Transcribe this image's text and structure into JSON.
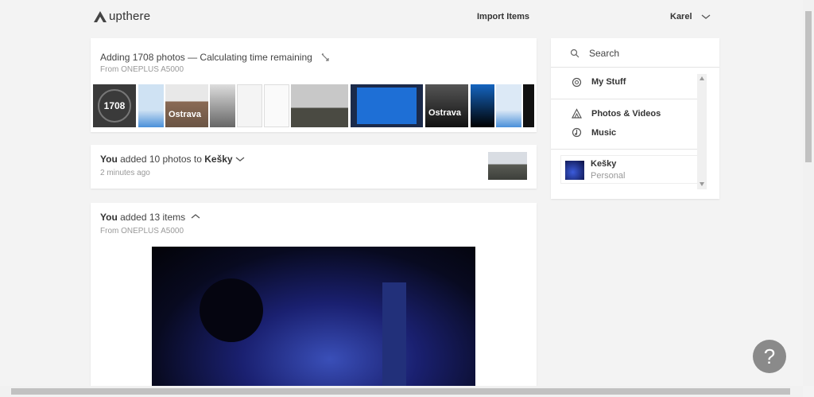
{
  "header": {
    "app_name": "upthere",
    "import_label": "Import Items",
    "user_name": "Karel"
  },
  "upload_card": {
    "title": "Adding 1708 photos — Calculating time remaining",
    "source": "From ONEPLUS A5000",
    "count": "1708",
    "thumbnail_labels": [
      "Ostrava",
      "Ostrava"
    ]
  },
  "activity_1": {
    "actor": "You",
    "text": "added 10 photos to",
    "target": "Kešky",
    "time": "2 minutes ago"
  },
  "activity_2": {
    "actor": "You",
    "text": "added 13 items",
    "source": "From ONEPLUS A5000"
  },
  "sidebar": {
    "search_label": "Search",
    "my_stuff_label": "My Stuff",
    "photos_videos_label": "Photos & Videos",
    "music_label": "Music",
    "folder": {
      "name": "Kešky",
      "type": "Personal"
    }
  },
  "help_label": "?",
  "colors": {
    "background": "#f3f3f3",
    "card": "#ffffff",
    "text": "#333333",
    "muted": "#999999"
  }
}
